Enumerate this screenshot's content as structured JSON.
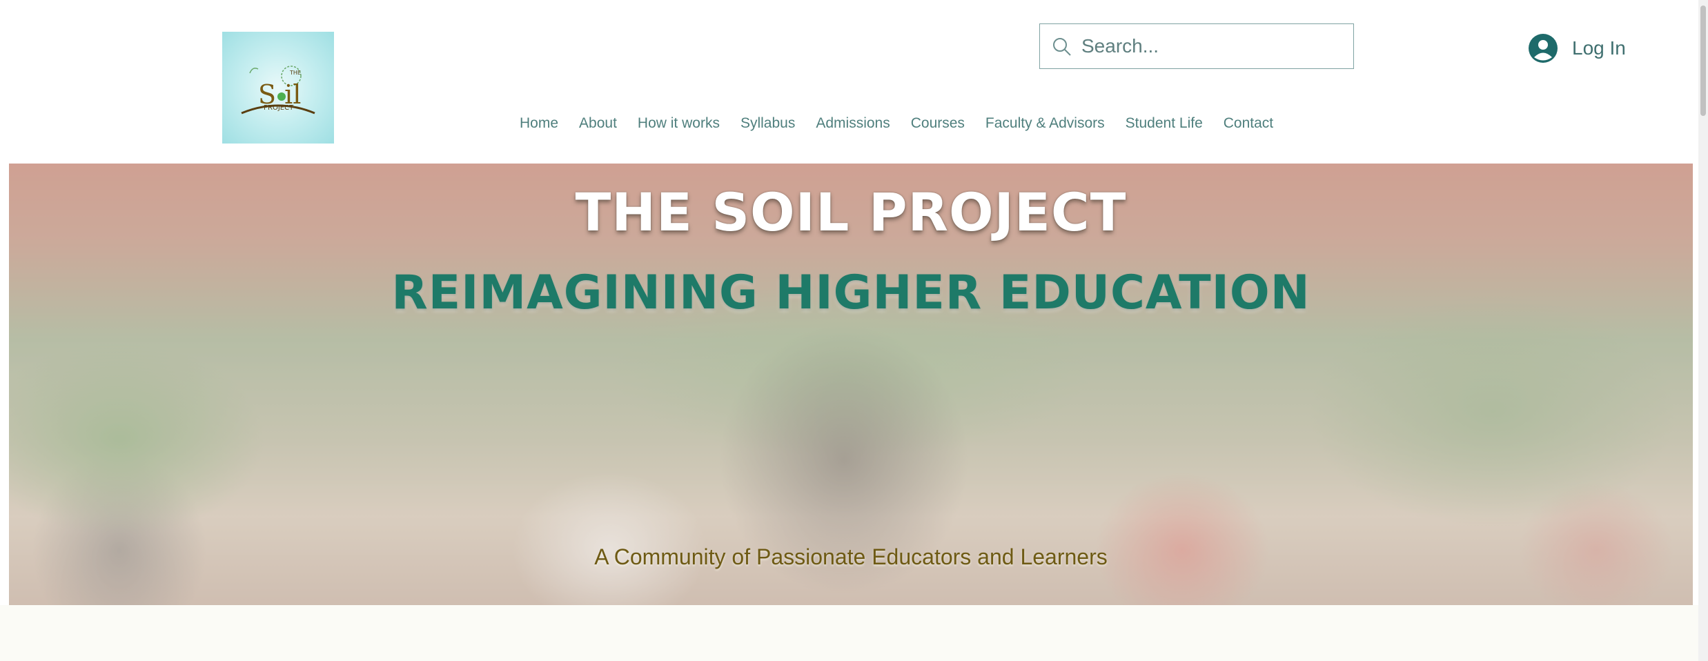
{
  "header": {
    "logo": {
      "text_the": "THE",
      "text_soil": "S il",
      "text_project": "PROJECT"
    },
    "search": {
      "placeholder": "Search..."
    },
    "login": {
      "label": "Log In"
    },
    "nav": [
      "Home",
      "About",
      "How it works",
      "Syllabus",
      "Admissions",
      "Courses",
      "Faculty & Advisors",
      "Student Life",
      "Contact"
    ]
  },
  "hero": {
    "title": "THE SOIL PROJECT",
    "heading": "REIMAGINING HIGHER EDUCATION",
    "tagline": "A Community of Passionate Educators and Learners"
  },
  "colors": {
    "nav_text": "#4f7f7d",
    "heading_green": "#1e7a68",
    "tagline_olive": "#6e5a14",
    "logo_bg": "#c6eef0"
  }
}
